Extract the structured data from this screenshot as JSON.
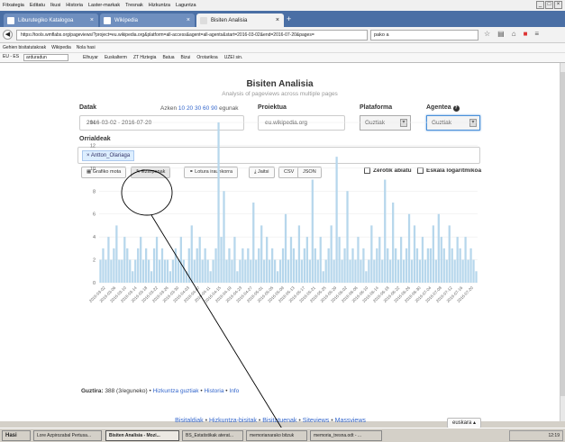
{
  "menubar": {
    "items": [
      "Fitxategia",
      "Editatu",
      "Ikusi",
      "Historia",
      "Laster-markak",
      "Tresnak",
      "Hizkuntza",
      "Laguntza"
    ]
  },
  "tabs": [
    {
      "label": "Liburutegiko Katalogoa"
    },
    {
      "label": "Wikipedia"
    },
    {
      "label": "Bisiten Analisia"
    }
  ],
  "navbar": {
    "url": "https://tools.wmflabs.org/pageviews/?project=eu.wikipedia.org&platform=all-access&agent=all-agents&start=2016-03-02&end=2016-07-20&pages=",
    "search_value": "pako a"
  },
  "bookmarks": [
    "Gehien bisitatutakoak",
    "Wikipedia",
    "Nola hasi"
  ],
  "toolbar2": {
    "selector": "EU - ES",
    "input_value": "arduradun",
    "links": [
      "Elhuyar",
      "Euskalterm",
      "ZT Hiztegia",
      "Batua",
      "Bizui",
      "Orotarikoa",
      "UZEI sin."
    ]
  },
  "app": {
    "title": "Bisiten Analisia",
    "subtitle": "Analysis of pageviews across multiple pages"
  },
  "form": {
    "dates_label": "Datak",
    "last_prefix": "Azken",
    "quick_ranges": [
      "10",
      "20",
      "30",
      "60",
      "90"
    ],
    "last_suffix": "egunak",
    "dates_value": "2016-03-02 - 2016-07-20",
    "project_label": "Proiektua",
    "project_value": "eu.wikipedia.org",
    "platform_label": "Plataforma",
    "platform_value": "Guztiak",
    "agent_label": "Agentea",
    "agent_value": "Guztiak",
    "pages_label": "Orrialdeak",
    "page_chip": "× Antton_Olariaga"
  },
  "toolbar": {
    "chart_type": "Grafiko mota",
    "settings": "Ezarpenak",
    "permalink": "Lotura iraunkorra",
    "download": "Jaitsi",
    "csv": "CSV",
    "json": "JSON",
    "zero_label": "Zerotik abiatu",
    "log_label": "Eskala logaritmikoa"
  },
  "chart_data": {
    "type": "bar",
    "ylim": [
      0,
      14
    ],
    "yticks": [
      0,
      2,
      4,
      6,
      8,
      10,
      12,
      14
    ],
    "x_tick_labels": [
      "2016-03-02",
      "2016-03-06",
      "2016-03-10",
      "2016-03-14",
      "2016-03-18",
      "2016-03-22",
      "2016-03-26",
      "2016-03-30",
      "2016-04-03",
      "2016-04-07",
      "2016-04-11",
      "2016-04-15",
      "2016-04-19",
      "2016-04-23",
      "2016-04-27",
      "2016-05-01",
      "2016-05-05",
      "2016-05-09",
      "2016-05-13",
      "2016-05-17",
      "2016-05-21",
      "2016-05-25",
      "2016-05-29",
      "2016-06-02",
      "2016-06-06",
      "2016-06-10",
      "2016-06-14",
      "2016-06-18",
      "2016-06-22",
      "2016-06-26",
      "2016-06-30",
      "2016-07-04",
      "2016-07-08",
      "2016-07-12",
      "2016-07-16",
      "2016-07-20"
    ],
    "values": [
      2,
      3,
      2,
      4,
      2,
      3,
      5,
      2,
      2,
      4,
      3,
      2,
      1,
      2,
      3,
      4,
      2,
      3,
      2,
      1,
      3,
      4,
      2,
      3,
      2,
      2,
      1,
      2,
      3,
      2,
      4,
      2,
      1,
      3,
      5,
      2,
      3,
      4,
      2,
      3,
      2,
      1,
      2,
      3,
      14,
      4,
      8,
      2,
      3,
      2,
      4,
      1,
      2,
      3,
      2,
      3,
      2,
      7,
      2,
      3,
      5,
      2,
      4,
      2,
      3,
      2,
      1,
      2,
      3,
      6,
      2,
      4,
      3,
      2,
      5,
      2,
      3,
      4,
      2,
      9,
      3,
      2,
      4,
      1,
      2,
      3,
      5,
      2,
      11,
      4,
      2,
      3,
      8,
      2,
      3,
      2,
      4,
      2,
      3,
      1,
      2,
      5,
      2,
      3,
      4,
      2,
      9,
      3,
      2,
      7,
      3,
      2,
      4,
      2,
      3,
      6,
      2,
      5,
      3,
      2,
      4,
      2,
      3,
      3,
      5,
      2,
      6,
      4,
      3,
      2,
      5,
      3,
      2,
      4,
      3,
      2,
      4,
      2,
      3,
      2,
      1
    ],
    "bar_color": "#b7d7ec"
  },
  "summary": {
    "total_label": "Guztira:",
    "total_value": "388 (3/eguneko)",
    "links": [
      "Hizkuntza guztiak",
      "Historia",
      "Info"
    ]
  },
  "footer": {
    "links": [
      "Bisitaldiak",
      "Hizkuntza-bisitak",
      "Bisitatuenak",
      "Siteviews",
      "Massviews"
    ],
    "language": "euskara ▴"
  },
  "taskbar": {
    "start": "Hasi",
    "items": [
      "Lore Azpirozabal Pertusa...",
      "Bisiten Analisia - Mozi...",
      "BS_Estatistikak aterat...",
      "memorianarako bitzuk",
      "memoria_tresna.odt - ..."
    ],
    "clock": "12:19"
  }
}
